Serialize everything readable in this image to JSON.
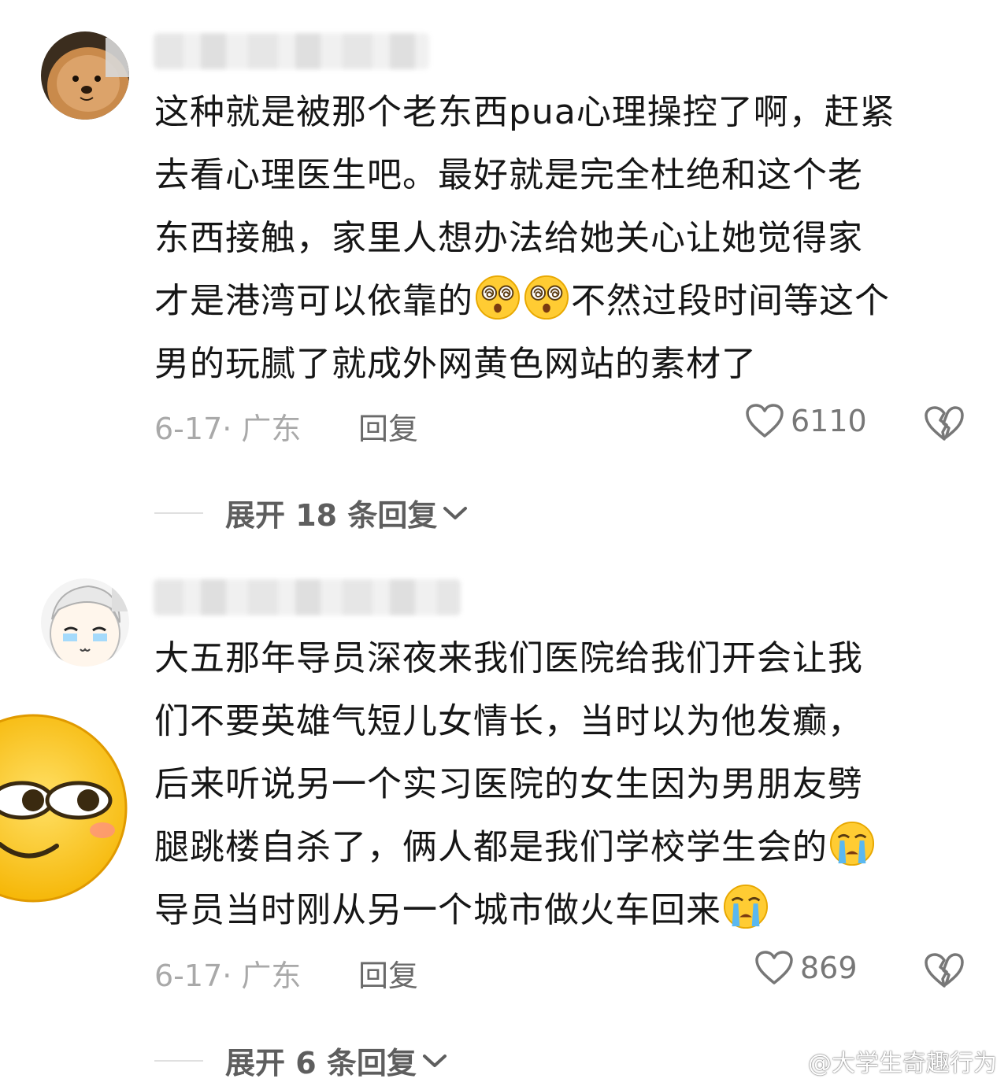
{
  "comments": [
    {
      "lines": [
        "这种就是被那个老东西pua心理操控了啊，赶紧",
        "去看心理医生吧。最好就是完全杜绝和这个老",
        "东西接触，家里人想办法给她关心让她觉得家",
        "才是港湾可以依靠的",
        "男的玩腻了就成外网黄色网站的素材了"
      ],
      "line4_tail": "不然过段时间等这个",
      "date_location": "6-17· 广东",
      "reply_label": "回复",
      "likes": "6110",
      "expand_label": "展开 18 条回复"
    },
    {
      "lines": [
        "大五那年导员深夜来我们医院给我们开会让我",
        "们不要英雄气短儿女情长，当时以为他发癫，",
        "后来听说另一个实习医院的女生因为男朋友劈",
        "腿跳楼自杀了，俩人都是我们学校学生会的",
        "导员当时刚从另一个城市做火车回来"
      ],
      "date_location": "6-17· 广东",
      "reply_label": "回复",
      "likes": "869",
      "expand_label": "展开 6 条回复"
    }
  ],
  "watermark": "@大学生奇趣行为",
  "icons": {
    "like": "heart-outline-icon",
    "dislike": "broken-heart-icon",
    "expand": "chevron-down-icon",
    "dizzy_emoji": "dizzy-face-emoji",
    "crying_emoji": "loudly-crying-emoji"
  }
}
